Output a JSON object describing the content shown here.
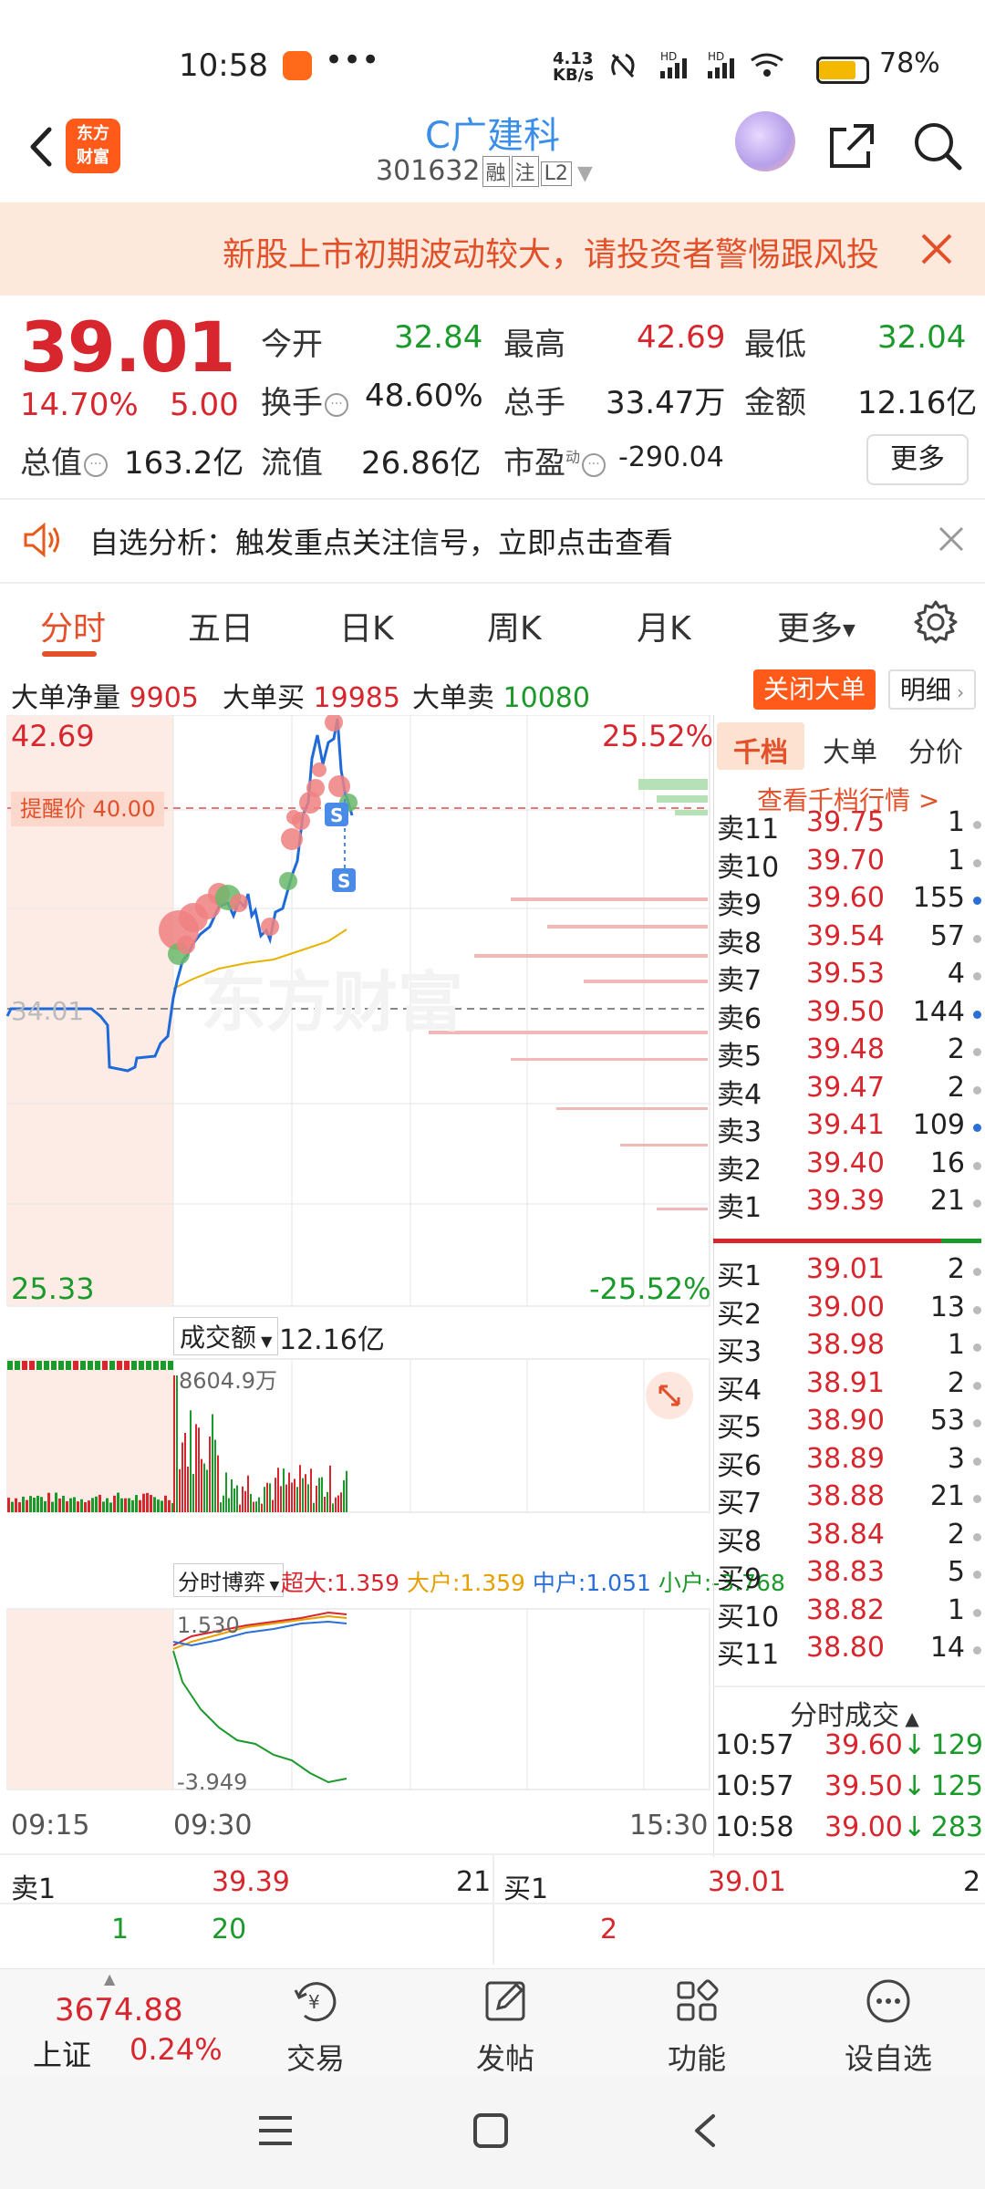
{
  "status_bar": {
    "time": "10:58",
    "more": "•••",
    "net_speed": "4.13 KB/s",
    "battery_pct": "78%"
  },
  "header": {
    "logo_line1": "东方",
    "logo_line2": "财富",
    "title": "C广建科",
    "code": "301632",
    "tags": [
      "融",
      "注",
      "L2"
    ]
  },
  "notice": {
    "text": "新股上市初期波动较大，请投资者警惕跟风投"
  },
  "quote": {
    "price": "39.01",
    "pct_change": "14.70%",
    "change": "5.00",
    "fields": [
      {
        "label": "今开",
        "value": "32.84",
        "color": "#1a9a2a"
      },
      {
        "label": "最高",
        "value": "42.69",
        "color": "#d8262e"
      },
      {
        "label": "最低",
        "value": "32.04",
        "color": "#1a9a2a"
      },
      {
        "label": "换手",
        "value": "48.60%",
        "color": "#222222"
      },
      {
        "label": "总手",
        "value": "33.47万",
        "color": "#222222"
      },
      {
        "label": "金额",
        "value": "12.16亿",
        "color": "#222222"
      },
      {
        "label": "总值",
        "value": "163.2亿",
        "color": "#222222"
      },
      {
        "label": "流值",
        "value": "26.86亿",
        "color": "#222222"
      },
      {
        "label": "市盈",
        "value": "-290.04",
        "color": "#222222"
      }
    ],
    "pe_sup": "动",
    "more_button": "更多"
  },
  "alert": {
    "text": "自选分析：触发重点关注信号，立即点击查看"
  },
  "tabs": [
    "分时",
    "五日",
    "日K",
    "周K",
    "月K",
    "更多"
  ],
  "big_order": {
    "net_label": "大单净量",
    "net_value": "9905",
    "buy_label": "大单买",
    "buy_value": "19985",
    "sell_label": "大单卖",
    "sell_value": "10080",
    "close_button": "关闭大单",
    "detail_button": "明细"
  },
  "chart": {
    "high": "42.69",
    "high_pct": "25.52%",
    "low": "25.33",
    "low_pct": "-25.52%",
    "prev_close": "34.01",
    "remind_label": "提醒价",
    "remind_price": "40.00",
    "watermark": "东方财富",
    "volume_label": "成交额",
    "volume_value": "12.16亿",
    "volume_max": "8604.9万",
    "flow_label": "分时博弈",
    "flow_super": "超大:1.359",
    "flow_large": "大户:1.359",
    "flow_mid": "中户:1.051",
    "flow_small": "小户:-3.768",
    "flow_top": "1.530",
    "flow_bottom": "-3.949",
    "time_start": "09:15",
    "time_open": "09:30",
    "time_end": "15:30"
  },
  "order_book": {
    "tabs": [
      "千档",
      "大单",
      "分价"
    ],
    "link": "查看千档行情 >",
    "asks": [
      {
        "label": "卖11",
        "price": "39.75",
        "vol": "1",
        "dot": "gray"
      },
      {
        "label": "卖10",
        "price": "39.70",
        "vol": "1",
        "dot": "gray"
      },
      {
        "label": "卖9",
        "price": "39.60",
        "vol": "155",
        "dot": "blue"
      },
      {
        "label": "卖8",
        "price": "39.54",
        "vol": "57",
        "dot": "gray"
      },
      {
        "label": "卖7",
        "price": "39.53",
        "vol": "4",
        "dot": "gray"
      },
      {
        "label": "卖6",
        "price": "39.50",
        "vol": "144",
        "dot": "blue"
      },
      {
        "label": "卖5",
        "price": "39.48",
        "vol": "2",
        "dot": "gray"
      },
      {
        "label": "卖4",
        "price": "39.47",
        "vol": "2",
        "dot": "gray"
      },
      {
        "label": "卖3",
        "price": "39.41",
        "vol": "109",
        "dot": "blue"
      },
      {
        "label": "卖2",
        "price": "39.40",
        "vol": "16",
        "dot": "gray"
      },
      {
        "label": "卖1",
        "price": "39.39",
        "vol": "21",
        "dot": "gray"
      }
    ],
    "bids": [
      {
        "label": "买1",
        "price": "39.01",
        "vol": "2",
        "dot": "gray"
      },
      {
        "label": "买2",
        "price": "39.00",
        "vol": "13",
        "dot": "gray"
      },
      {
        "label": "买3",
        "price": "38.98",
        "vol": "1",
        "dot": "gray"
      },
      {
        "label": "买4",
        "price": "38.91",
        "vol": "2",
        "dot": "gray"
      },
      {
        "label": "买5",
        "price": "38.90",
        "vol": "53",
        "dot": "gray"
      },
      {
        "label": "买6",
        "price": "38.89",
        "vol": "3",
        "dot": "gray"
      },
      {
        "label": "买7",
        "price": "38.88",
        "vol": "21",
        "dot": "gray"
      },
      {
        "label": "买8",
        "price": "38.84",
        "vol": "2",
        "dot": "gray"
      },
      {
        "label": "买9",
        "price": "38.83",
        "vol": "5",
        "dot": "gray"
      },
      {
        "label": "买10",
        "price": "38.82",
        "vol": "1",
        "dot": "gray"
      },
      {
        "label": "买11",
        "price": "38.80",
        "vol": "14",
        "dot": "gray"
      }
    ],
    "ticks_header": "分时成交",
    "ticks": [
      {
        "time": "10:57",
        "price": "39.60",
        "arrow": "↓",
        "vol": "129"
      },
      {
        "time": "10:57",
        "price": "39.50",
        "arrow": "↓",
        "vol": "125"
      },
      {
        "time": "10:58",
        "price": "39.00",
        "arrow": "↓",
        "vol": "283"
      }
    ]
  },
  "bottom_quote": {
    "sell_label": "卖1",
    "sell_price": "39.39",
    "sell_vol": "21",
    "buy_label": "买1",
    "buy_price": "39.01",
    "buy_vol": "2",
    "sell_sub1": "1",
    "sell_sub2": "20",
    "buy_sub1": "2"
  },
  "nav": {
    "index_value": "3674.88",
    "index_name": "上证",
    "index_pct": "0.24%",
    "items": [
      "交易",
      "发帖",
      "功能",
      "设自选"
    ]
  }
}
